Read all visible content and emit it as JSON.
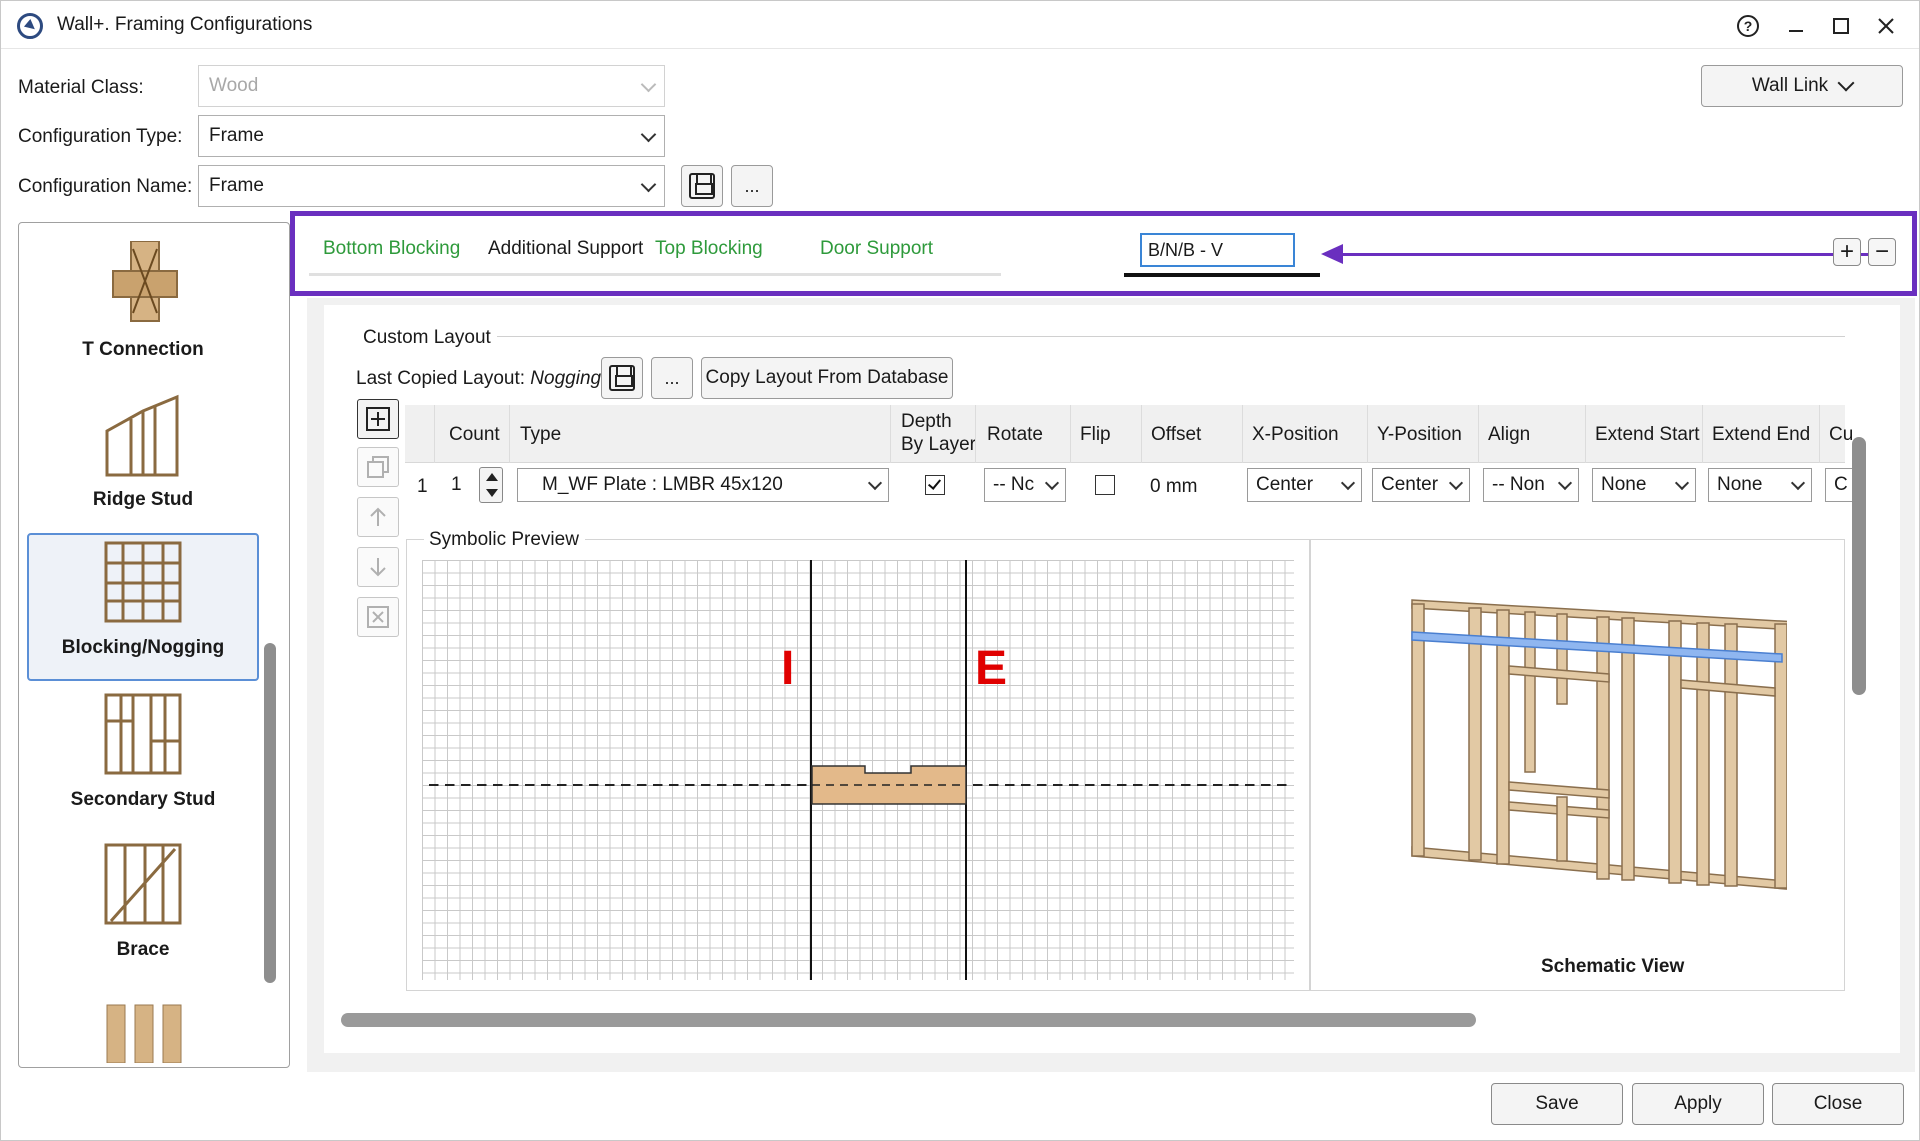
{
  "window": {
    "title": "Wall+. Framing Configurations",
    "help": "?",
    "minimize": "—",
    "maximize": "☐",
    "close": "✕"
  },
  "form": {
    "material_class": {
      "label": "Material Class:",
      "value": "Wood"
    },
    "configuration_type": {
      "label": "Configuration Type:",
      "value": "Frame"
    },
    "configuration_name": {
      "label": "Configuration Name:",
      "value": "Frame"
    },
    "more_button": "..."
  },
  "wall_link": "Wall Link",
  "left_panel": {
    "items": [
      {
        "label": "T Connection",
        "selected": false
      },
      {
        "label": "Ridge Stud",
        "selected": false
      },
      {
        "label": "Blocking/Nogging",
        "selected": true
      },
      {
        "label": "Secondary Stud",
        "selected": false
      },
      {
        "label": "Brace",
        "selected": false
      }
    ]
  },
  "tabs": {
    "items": [
      {
        "label": "Bottom Blocking",
        "color": "#2e9a3b"
      },
      {
        "label": "Additional Support",
        "color": "#1a1a1a"
      },
      {
        "label": "Top Blocking",
        "color": "#2e9a3b"
      },
      {
        "label": "Door Support",
        "color": "#2e9a3b"
      }
    ],
    "editing_value": "B/N/B - V",
    "add": "+",
    "remove": "−",
    "highlight_color": "#6a2fbf"
  },
  "custom_layout": {
    "title": "Custom Layout",
    "last_copied_label": "Last Copied Layout:",
    "last_copied_value": "Nogging",
    "more_button": "...",
    "copy_button": "Copy Layout From Database"
  },
  "table": {
    "headers": {
      "count": "Count",
      "type": "Type",
      "depth_by_layer": "Depth\nBy Layer",
      "rotate": "Rotate",
      "flip": "Flip",
      "offset": "Offset",
      "x_position": "X-Position",
      "y_position": "Y-Position",
      "align": "Align",
      "extend_start": "Extend Start",
      "extend_end": "Extend End",
      "cut": "Cu"
    },
    "rows": [
      {
        "index": "1",
        "count": "1",
        "type": "M_WF Plate : LMBR 45x120",
        "depth_by_layer": true,
        "rotate": "-- Nc",
        "flip": false,
        "offset": "0 mm",
        "x_position": "Center",
        "y_position": "Center",
        "align": "-- Non",
        "extend_start": "None",
        "extend_end": "None",
        "cut": "C"
      }
    ]
  },
  "preview": {
    "symbolic_title": "Symbolic Preview",
    "interior_label": "I",
    "exterior_label": "E",
    "schematic_caption": "Schematic View"
  },
  "footer": {
    "save": "Save",
    "apply": "Apply",
    "close": "Close"
  }
}
